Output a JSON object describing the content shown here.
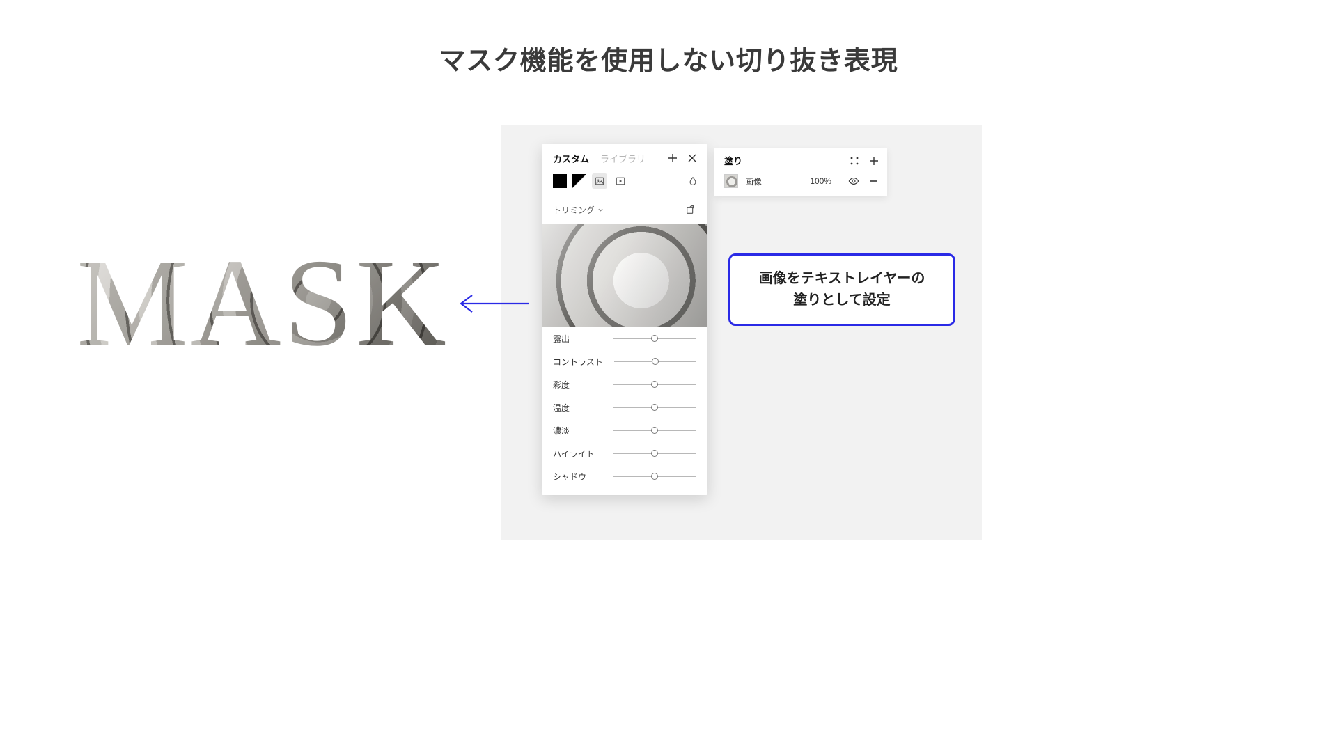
{
  "page": {
    "title": "マスク機能を使用しない切り抜き表現",
    "mask_text": "MASK"
  },
  "popover": {
    "tabs": {
      "custom": "カスタム",
      "library": "ライブラリ"
    },
    "crop_label": "トリミング",
    "sliders": [
      {
        "label": "露出"
      },
      {
        "label": "コントラスト"
      },
      {
        "label": "彩度"
      },
      {
        "label": "温度"
      },
      {
        "label": "濃淡"
      },
      {
        "label": "ハイライト"
      },
      {
        "label": "シャドウ"
      }
    ]
  },
  "fill_panel": {
    "title": "塗り",
    "row": {
      "name": "画像",
      "opacity": "100%"
    }
  },
  "callout": {
    "line1": "画像をテキストレイヤーの",
    "line2": "塗りとして設定"
  },
  "colors": {
    "accent": "#2a2ae6"
  }
}
